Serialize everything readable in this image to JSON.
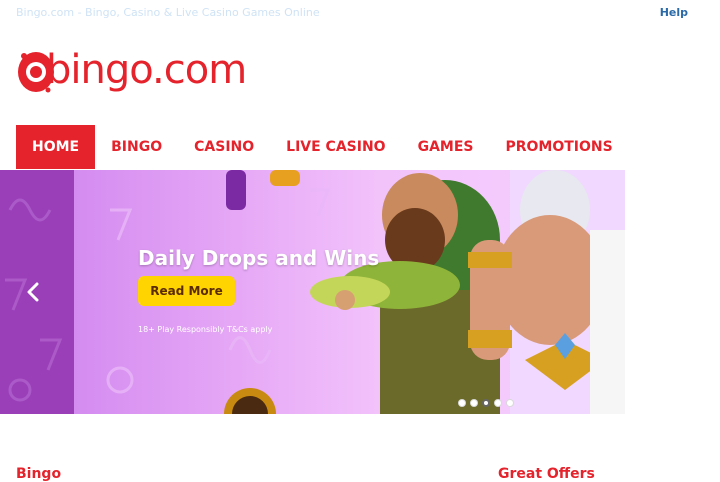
{
  "topbar": {
    "tagline": "Bingo.com - Bingo, Casino & Live Casino Games Online",
    "help": "Help"
  },
  "logo": {
    "text": "bingo.com"
  },
  "nav": [
    {
      "label": "HOME",
      "active": true
    },
    {
      "label": "BINGO",
      "active": false
    },
    {
      "label": "CASINO",
      "active": false
    },
    {
      "label": "LIVE CASINO",
      "active": false
    },
    {
      "label": "GAMES",
      "active": false
    },
    {
      "label": "PROMOTIONS",
      "active": false
    }
  ],
  "banner": {
    "title": "Daily Drops and Wins",
    "cta": "Read More",
    "disclaimer": "18+ Play Responsibly T&Cs apply",
    "prev_icon": "chevron-left-icon",
    "slides": 5,
    "active_slide": 3
  },
  "sections": {
    "left_title": "Bingo",
    "right_title": "Great Offers"
  },
  "colors": {
    "brand_red": "#e4232c",
    "cta_yellow": "#ffd400",
    "banner_purple": "#c98ae6"
  }
}
